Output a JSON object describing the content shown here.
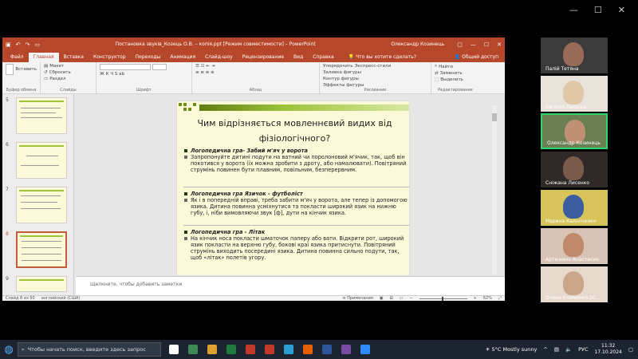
{
  "ppt": {
    "title": "Постановка звуків_Козець О.В. – копія.ppt [Режим совместимости] – PowerPoint",
    "user": "Олександр Козинець",
    "tabs": [
      "Файл",
      "Главная",
      "Вставка",
      "Конструктор",
      "Переходы",
      "Анимация",
      "Слайд-шоу",
      "Рецензирование",
      "Вид",
      "Справка"
    ],
    "active_tab": "Главная",
    "tellme": "Что вы хотите сделать?",
    "share": "Общий доступ",
    "ribbon": {
      "paste": "Вставить",
      "clipboard_group": "Буфер обмена",
      "create_slide": "Создать слайд",
      "layout": "Макет",
      "reset": "Сбросить",
      "section": "Раздел",
      "slides_group": "Слайды",
      "font_group": "Шрифт",
      "paragraph_group": "Абзац",
      "arrange": "Упорядочить",
      "quick_styles": "Экспресс-стили",
      "shape_fill": "Заливка фигуры",
      "shape_outline": "Контур фигуры",
      "shape_effects": "Эффекты фигуры",
      "drawing_group": "Рисование",
      "find": "Найти",
      "replace": "Заменить",
      "select": "Выделить",
      "editing_group": "Редактирование"
    },
    "thumb_numbers": [
      "5",
      "6",
      "7",
      "8",
      "9"
    ],
    "slide": {
      "title": "Чим відрізняється мовленнєвий видих від фізіологічного?",
      "sections": [
        {
          "heading": "Логопедична гра- Забий м'яч у ворота",
          "body": "Запропонуйте дитині подути на ватний чи поролоновий м'ячик, так, щоб він покотився у ворота (їх можна зробити з дроту, або намалювати). Повітряний струмінь повинен бути плавним, повільним, безперервним."
        },
        {
          "heading": "Логопедична гра Язичок - футболіст",
          "body": "Як і в попередній вправі, треба забити м'яч у ворота, але тепер із допомогою язика. Дитина повинна усміхнутися та покласти широкий язик на нижню губу, і, ніби вимовляючи звук [ф], дути на кінчик язика."
        },
        {
          "heading": "Логопедична гра - Літак",
          "body": "На кінчик носа покласти шматочок паперу або вати. Відкрити рот, широкий язик покласти на верхню губу, бокові краї язика притиснути. Повітряний струмінь виходить посередині язика. Дитина повинна сильно подути, так, щоб «літак» полетів угору."
        }
      ]
    },
    "notes_placeholder": "Щелкните, чтобы добавить заметки",
    "status": {
      "slide_of": "Слайд 8 из 50",
      "language": "английский (США)",
      "notes": "Примечания",
      "zoom": "62%"
    }
  },
  "participants": [
    {
      "name": "Палій Тетяна",
      "color": "#7a5a4a"
    },
    {
      "name": "Євгенія Ленціна",
      "color": "#d9c7b8"
    },
    {
      "name": "Олександр Козинець",
      "color": "#6d8a4a"
    },
    {
      "name": "Сніжана Лисенко",
      "color": "#b49a88"
    },
    {
      "name": "Марина Калініченко",
      "color": "#c9b040"
    },
    {
      "name": "Артюнина Анастасия",
      "color": "#c7a28a"
    },
    {
      "name": "Олена Клименко 20...",
      "color": "#d8c0a8"
    }
  ],
  "taskbar": {
    "search_placeholder": "Чтобы начать поиск, введите здесь запрос",
    "weather": "5°C  Mostly sunny",
    "lang": "РУС",
    "time": "11:32",
    "date": "17.10.2024"
  }
}
